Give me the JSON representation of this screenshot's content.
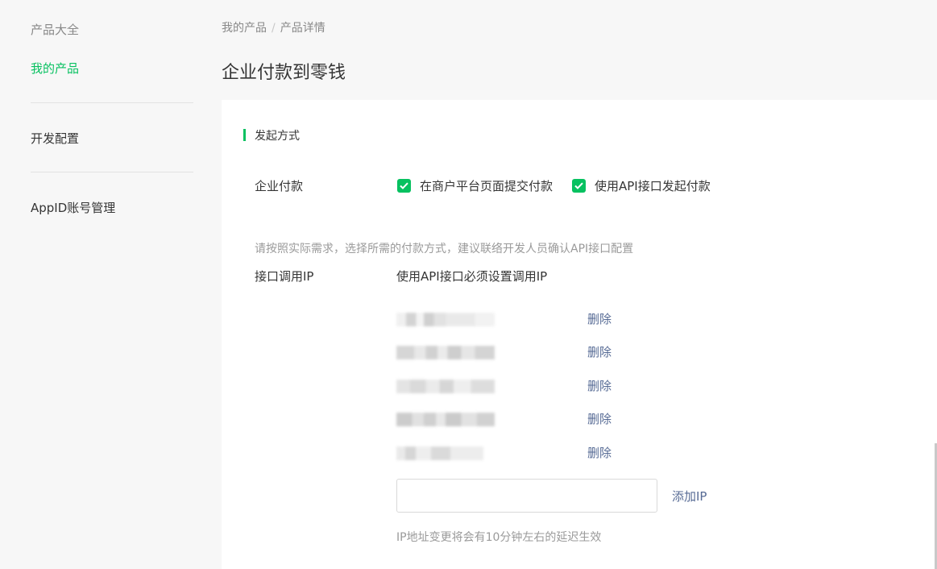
{
  "sidebar": {
    "items": [
      {
        "label": "产品大全"
      },
      {
        "label": "我的产品"
      },
      {
        "label": "开发配置"
      },
      {
        "label": "AppID账号管理"
      }
    ]
  },
  "breadcrumb": {
    "parent": "我的产品",
    "separator": "/",
    "current": "产品详情"
  },
  "page": {
    "title": "企业付款到零钱"
  },
  "section": {
    "title": "发起方式"
  },
  "payment": {
    "label": "企业付款",
    "options": [
      {
        "label": "在商户平台页面提交付款",
        "checked": true
      },
      {
        "label": "使用API接口发起付款",
        "checked": true
      }
    ]
  },
  "hint": "请按照实际需求，选择所需的付款方式，建议联络开发人员确认API接口配置",
  "ip_config": {
    "label": "接口调用IP",
    "description": "使用API接口必须设置调用IP",
    "ips": [
      {
        "delete_label": "删除"
      },
      {
        "delete_label": "删除"
      },
      {
        "delete_label": "删除"
      },
      {
        "delete_label": "删除"
      },
      {
        "delete_label": "删除"
      }
    ],
    "input_value": "",
    "add_label": "添加IP",
    "note": "IP地址变更将会有10分钟左右的延迟生效"
  },
  "colors": {
    "accent": "#07c160",
    "link": "#576b95"
  }
}
